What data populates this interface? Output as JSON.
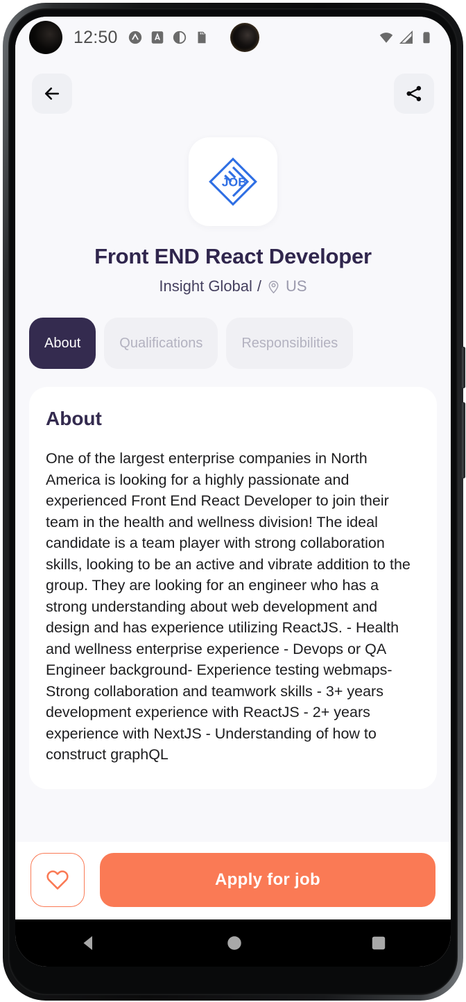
{
  "status_bar": {
    "time": "12:50",
    "icons": [
      "circle-chevron-icon",
      "a-box-icon",
      "half-circle-icon",
      "sd-card-icon"
    ],
    "right_icons": [
      "wifi-icon",
      "cellular-signal-icon",
      "battery-icon"
    ]
  },
  "topbar": {
    "back_icon": "arrow-left-icon",
    "share_icon": "share-icon"
  },
  "header": {
    "logo_text": "JOB",
    "job_title": "Front END React Developer",
    "company": "Insight Global",
    "separator": "/",
    "location": "US",
    "location_icon": "map-pin-icon"
  },
  "tabs": [
    {
      "label": "About",
      "active": true
    },
    {
      "label": "Qualifications",
      "active": false
    },
    {
      "label": "Responsibilities",
      "active": false
    }
  ],
  "content": {
    "section_title": "About",
    "body": "One of the largest enterprise companies in North America is looking for a highly passionate and experienced Front End React Developer to join their team in the health and wellness division! The ideal candidate is a team player with strong collaboration skills, looking to be an active and vibrate addition to the group. They are looking for an engineer who has a strong understanding about web development and design and has experience utilizing ReactJS. - Health and wellness enterprise experience - Devops or QA Engineer background- Experience testing webmaps- Strong collaboration and teamwork skills - 3+ years development experience with ReactJS - 2+ years experience with NextJS - Understanding of how to construct graphQL"
  },
  "bottom_bar": {
    "favorite_icon": "heart-outline-icon",
    "apply_label": "Apply for job"
  },
  "android_nav": {
    "back_icon": "nav-back-triangle-icon",
    "home_icon": "nav-home-circle-icon",
    "recents_icon": "nav-recents-square-icon"
  },
  "colors": {
    "accent_dark": "#342b4f",
    "accent_coral": "#fa7a55",
    "page_bg": "#f8f8fb",
    "logo_blue": "#2f6fe4"
  }
}
